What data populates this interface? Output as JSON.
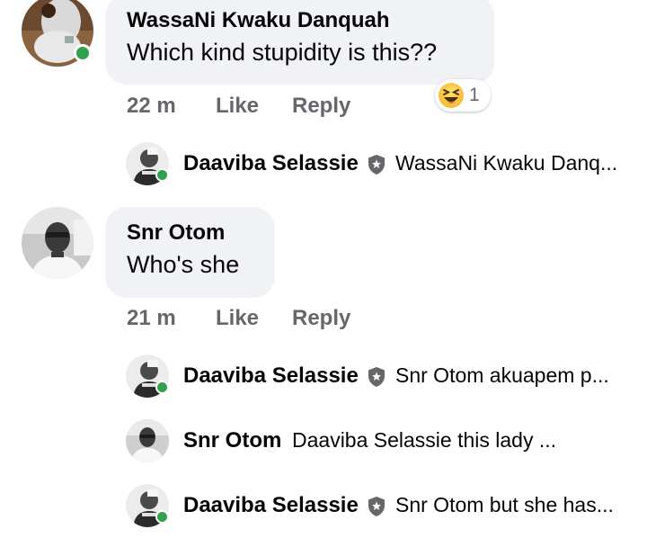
{
  "comments": [
    {
      "author": "WassaNi Kwaku Danquah",
      "text": "Which kind stupidity is this??",
      "time": "22 m",
      "like_label": "Like",
      "reply_label": "Reply",
      "reaction": {
        "icon": "laughing-emoji-icon",
        "count": "1"
      },
      "online": true
    },
    {
      "author": "Snr Otom",
      "text": "Who's she",
      "time": "21 m",
      "like_label": "Like",
      "reply_label": "Reply",
      "online": false
    }
  ],
  "replies": [
    {
      "author": "Daaviba Selassie",
      "badge_icon": "shield-star-icon",
      "preview": "WassaNi Kwaku Danq...",
      "online": true
    },
    {
      "author": "Daaviba Selassie",
      "badge_icon": "shield-star-icon",
      "preview": "Snr Otom akuapem p...",
      "online": true
    },
    {
      "author": "Snr Otom",
      "preview": "Daaviba Selassie this lady ...",
      "online": false
    },
    {
      "author": "Daaviba Selassie",
      "badge_icon": "shield-star-icon",
      "preview": "Snr Otom but she has...",
      "online": true
    }
  ],
  "colors": {
    "bubble": "#f0f2f5",
    "secondary_text": "#65676b",
    "online_dot": "#31a24c"
  }
}
